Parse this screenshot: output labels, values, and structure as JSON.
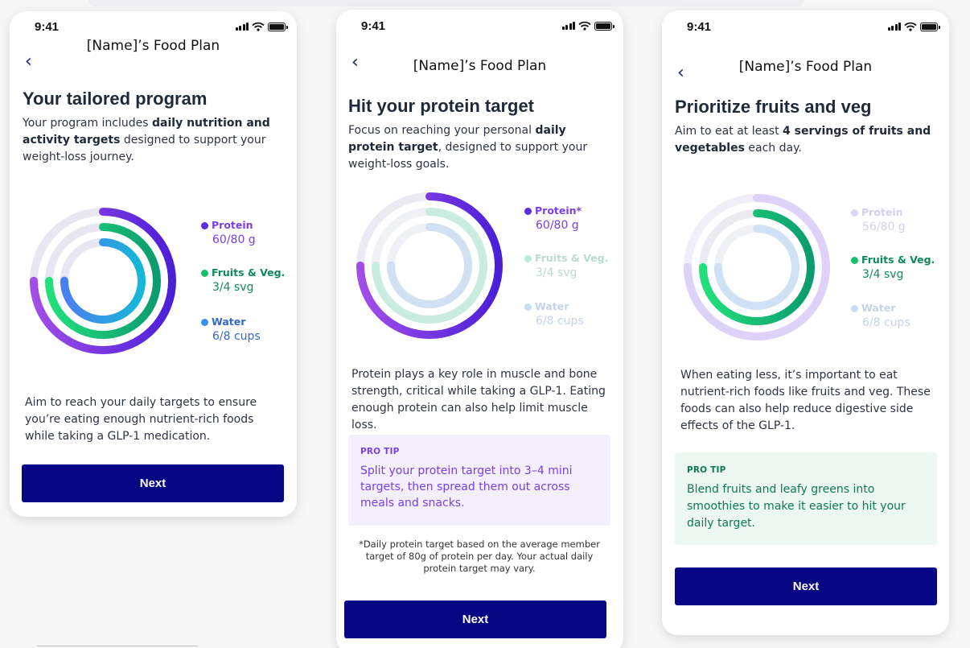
{
  "status_time": "9:41",
  "screens": [
    {
      "nav_title": "[Name]’s Food Plan",
      "heading": "Your tailored program",
      "intro": {
        "pre": "Your program includes ",
        "bold": "daily nutrition and activity targets",
        "post": " designed to support your weight-loss journey."
      },
      "legend": [
        {
          "name": "Protein",
          "value": "60/80 g",
          "color": "#5b2ee0",
          "value_color": "#7a3fe4"
        },
        {
          "name": "Fruits & Veg.",
          "value": "3/4 svg",
          "color": "#18c06e",
          "value_color": "#0e8a58"
        },
        {
          "name": "Water",
          "value": "6/8 cups",
          "color": "#3a8ff0",
          "value_color": "#3468c8"
        }
      ],
      "body": "Aim to reach your daily targets to ensure you’re eating enough nutrient-rich foods while taking a GLP-1 medication.",
      "button": "Next"
    },
    {
      "nav_title": "[Name]’s Food Plan",
      "heading": "Hit your protein target",
      "intro": {
        "pre": "Focus on reaching your personal ",
        "bold": "daily protein target",
        "post": ", designed to support your weight-loss goals."
      },
      "legend": [
        {
          "name": "Protein*",
          "value": "60/80 g",
          "color": "#5b2ee0",
          "value_color": "#7a3fe4"
        },
        {
          "name": "Fruits & Veg.",
          "value": "3/4 svg",
          "color": "#b9ecd7",
          "value_color": "#b9dccf"
        },
        {
          "name": "Water",
          "value": "6/8 cups",
          "color": "#c9dcf6",
          "value_color": "#c4d3ea"
        }
      ],
      "body": "Protein plays a key role in muscle and bone strength, critical while taking a GLP-1. Eating enough protein can also help limit muscle loss.",
      "tip_label": "PRO TIP",
      "tip_text": "Split your protein target into 3–4 mini targets, then spread them out across meals and snacks.",
      "footnote": "*Daily protein target based on the average member target of 80g of protein per day. Your actual daily protein target may vary.",
      "button": "Next"
    },
    {
      "nav_title": "[Name]’s Food Plan",
      "heading": "Prioritize fruits and veg",
      "intro": {
        "pre": "Aim to eat at least ",
        "bold": "4 servings of fruits and vegetables",
        "post": " each day."
      },
      "legend": [
        {
          "name": "Protein",
          "value": "56/80 g",
          "color": "#ddd2f7",
          "value_color": "#d6cdef"
        },
        {
          "name": "Fruits & Veg.",
          "value": "3/4 svg",
          "color": "#18c06e",
          "value_color": "#0e8a58"
        },
        {
          "name": "Water",
          "value": "6/8 cups",
          "color": "#c9dcf6",
          "value_color": "#c4d3ea"
        }
      ],
      "body": "When eating less, it’s important to eat nutrient-rich foods like fruits and veg. These foods can also help reduce digestive side effects of the GLP-1.",
      "tip_label": "PRO TIP",
      "tip_text": "Blend fruits and leafy greens into smoothies to make it easier to hit your daily target.",
      "button": "Next"
    }
  ],
  "ring_progress": {
    "protein": 0.75,
    "fruits_veg": 0.75,
    "water": 0.75
  }
}
